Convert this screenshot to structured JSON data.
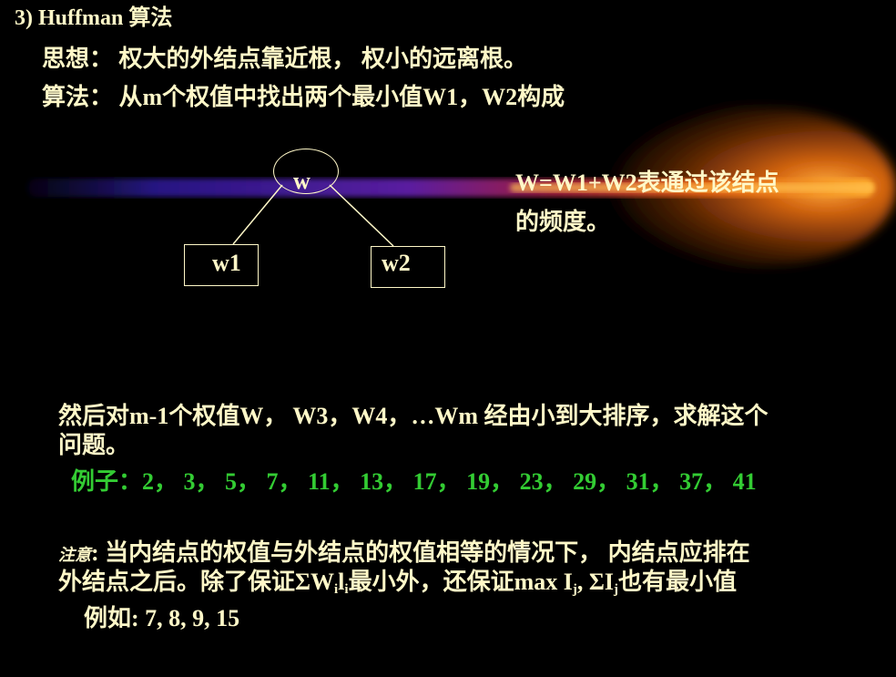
{
  "heading": "3) Huffman 算法",
  "idea_line": "思想： 权大的外结点靠近根， 权小的远离根。",
  "algo_line": "算法： 从m个权值中找出两个最小值W1，W2构成",
  "tree": {
    "root": "w",
    "left": "w1",
    "right": "w2"
  },
  "tree_caption_1": "W=W1+W2表通过该结点",
  "tree_caption_2": "的频度。",
  "then_line_1": "然后对m-1个权值W， W3，W4，…Wm 经由小到大排序，求解这个",
  "then_line_2": "问题。",
  "example_line": "例子：2， 3， 5， 7， 11， 13， 17， 19， 23， 29， 31， 37， 41",
  "note": {
    "label": "注意",
    "line1_rest": ": 当内结点的权值与外结点的权值相等的情况下， 内结点应排在",
    "line2_a": "外结点之后。除了保证ΣW",
    "sub_i1": "i",
    "line2_b": "l",
    "sub_i2": "i",
    "line2_c": "最小外，还保证max I",
    "sub_j1": "j",
    "line2_d": ", ΣI",
    "sub_j2": "j",
    "line2_e": "也有最小值"
  },
  "for_example": "例如: 7, 8, 9, 15",
  "colors": {
    "background": "#000000",
    "text": "#fff8c8",
    "example": "#33cc33",
    "beam_core": "#ffa020",
    "beam_edge": "#3a2ab0"
  }
}
